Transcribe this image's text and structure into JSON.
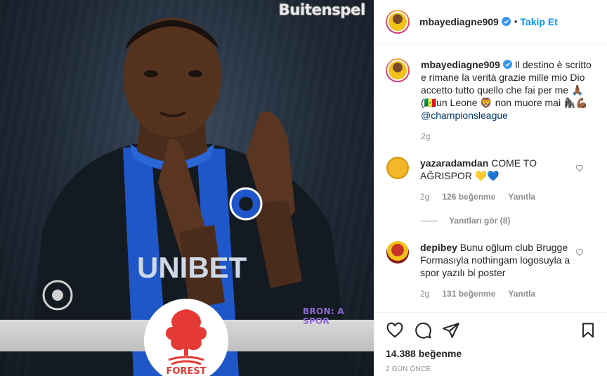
{
  "media": {
    "watermark": "Buitenspel",
    "tag": "BRON: A SPOR",
    "sponsor": "UNIBET",
    "badge_text": "FOREST"
  },
  "header": {
    "username": "mbayediagne909",
    "separator": "•",
    "follow_label": "Takip Et"
  },
  "caption": {
    "username": "mbayediagne909",
    "text_part1": "Il destino è scritto e rimane la verità grazie mille mio Dio accetto tutto quello che fai per me 🙏🏾(🇸🇳un Leone 🦁 non muore mai 🦍💪🏾 ",
    "mention": "@championsleague",
    "time": "2g"
  },
  "comments": [
    {
      "username": "yazaradamdan",
      "text": "COME TO AĞRISPOR 💛💙",
      "time": "2g",
      "likes": "126 beğenme",
      "reply_label": "Yanıtla",
      "view_replies": "Yanıtları gör (8)"
    },
    {
      "username": "depibey",
      "text": "Bunu oğlum club Brugge Formasıyla nothingam logosuyla a spor yazılı bi poster",
      "time": "2g",
      "likes": "131 beğenme",
      "reply_label": "Yanıtla"
    }
  ],
  "footer": {
    "likes": "14.388 beğenme",
    "date": "2 GÜN ÖNCE"
  },
  "icons": [
    "heart-icon",
    "comment-icon",
    "share-icon",
    "bookmark-icon",
    "verified-icon",
    "like-comment-icon"
  ],
  "colors": {
    "link": "#0095f6",
    "muted": "#8e8e8e",
    "text": "#262626",
    "tag": "#8e6ad6"
  }
}
